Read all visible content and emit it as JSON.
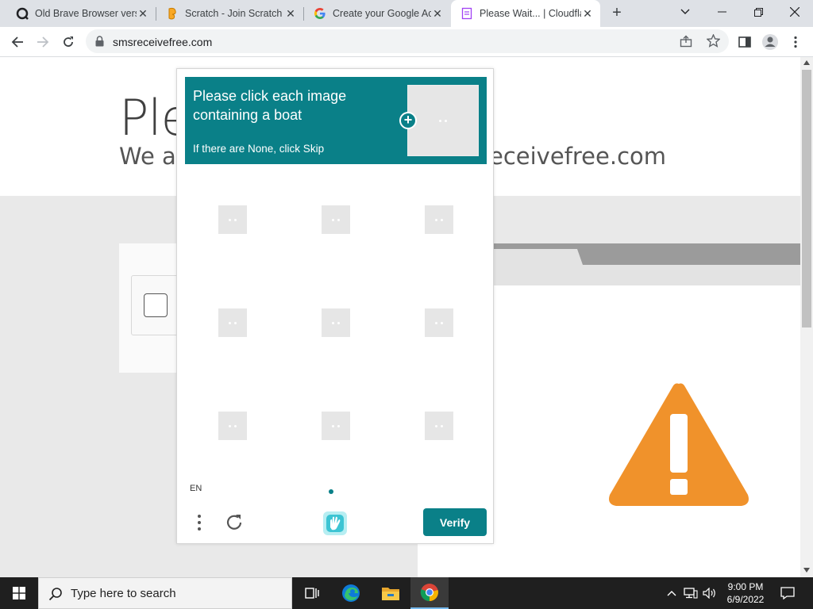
{
  "browser": {
    "tabs": [
      {
        "title": "Old Brave Browser vers",
        "favicon": "brave-search-icon",
        "active": false
      },
      {
        "title": "Scratch - Join Scratch",
        "favicon": "scratch-icon",
        "active": false
      },
      {
        "title": "Create your Google Ac",
        "favicon": "google-icon",
        "active": false
      },
      {
        "title": "Please Wait... | Cloudfla",
        "favicon": "page-icon",
        "active": true
      }
    ],
    "new_tab": "+",
    "close_glyph": "✕",
    "url": "smsreceivefree.com"
  },
  "page": {
    "title": "Ple",
    "subtitle": "We ar",
    "subtitle_domain": "eceivefree.com"
  },
  "captcha": {
    "prompt": "Please click each image containing a boat",
    "skip_hint": "If there are None, click Skip",
    "language": "EN",
    "verify_label": "Verify",
    "brand_color": "#0a8088"
  },
  "taskbar": {
    "search_placeholder": "Type here to search",
    "time": "9:00 PM",
    "date": "6/9/2022"
  }
}
